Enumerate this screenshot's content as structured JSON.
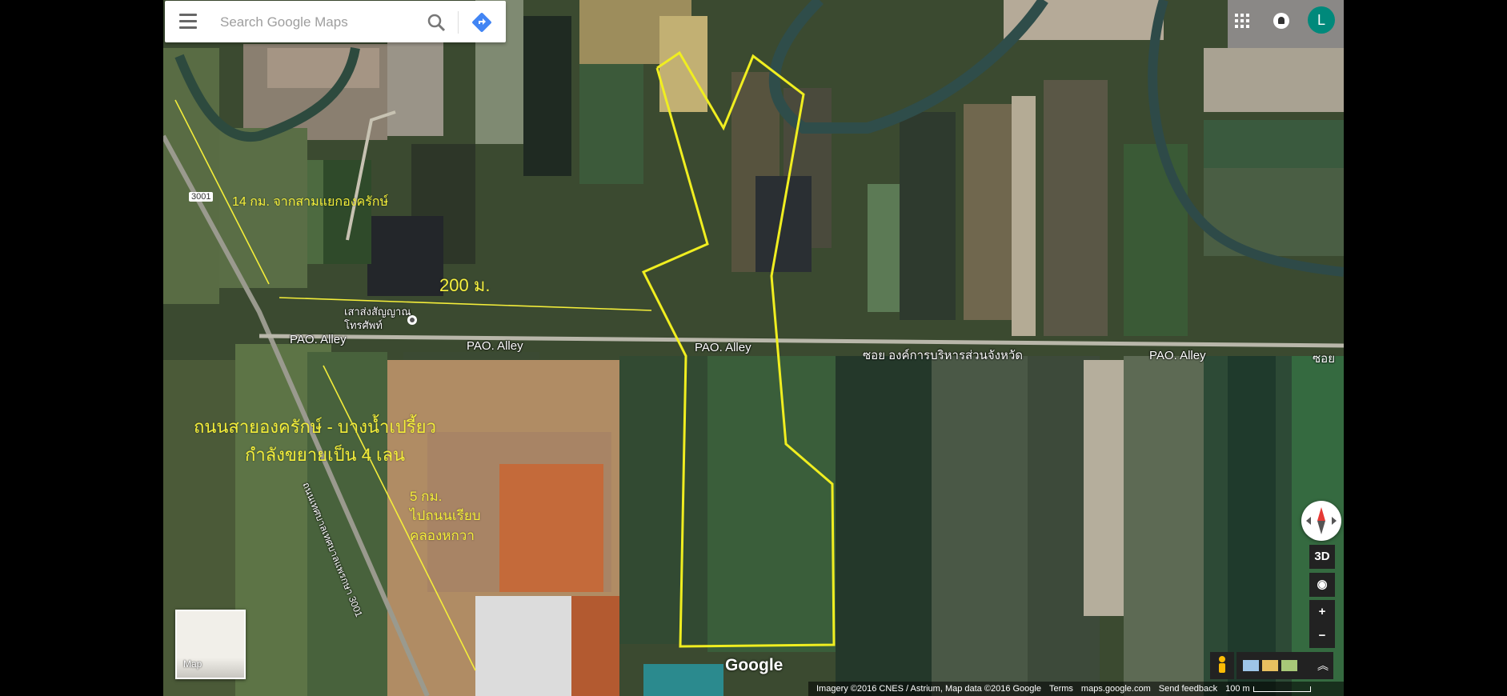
{
  "search": {
    "placeholder": "Search Google Maps",
    "menu_icon": "hamburger-menu-icon",
    "search_icon": "magnifier-icon",
    "directions_icon": "directions-diamond-icon"
  },
  "header": {
    "apps_icon": "apps-grid-icon",
    "notifications_icon": "bell-icon",
    "avatar_initial": "L",
    "avatar_color": "#00897b"
  },
  "map_labels": {
    "road_alley_1": "PAO. Alley",
    "road_alley_2": "PAO. Alley",
    "road_alley_3": "PAO. Alley",
    "road_alley_4": "PAO. Alley",
    "road_thai": "ซอย องค์การบริหารส่วนจังหวัด",
    "route_shield": "3001",
    "road_vertical": "ถนนเทศบาลเทศบาลแพรกษา 3001",
    "poi": "เสาส่งสัญญาณโทรศัพท์",
    "edge_fragment": "ซอย"
  },
  "annotations": {
    "distance_14km": "14 กม. จากสามแยกองครักษ์",
    "distance_200m": "200 ม.",
    "road_name": "ถนนสายองครักษ์ - บางน้ำเปรี้ยว",
    "widening": "กำลังขยายเป็น 4 เลน",
    "distance_5km_line1": "5 กม.",
    "distance_5km_line2": "ไปถนนเรียบ",
    "distance_5km_line3": "คลองหกวา",
    "annotation_color": "#f4ee3a"
  },
  "controls": {
    "map_thumb_label": "Map",
    "btn_3d": "3D",
    "btn_zoom_in": "+",
    "btn_zoom_out": "−",
    "compass_icon": "compass-icon",
    "location_icon": "my-location-icon",
    "pegman_icon": "pegman-icon",
    "expand_icon": "chevron-up-icon"
  },
  "footer": {
    "google_logo": "Google",
    "imagery": "Imagery ©2016 CNES / Astrium, Map data ©2016 Google",
    "terms": "Terms",
    "site": "maps.google.com",
    "feedback": "Send feedback",
    "scale": "100 m"
  }
}
